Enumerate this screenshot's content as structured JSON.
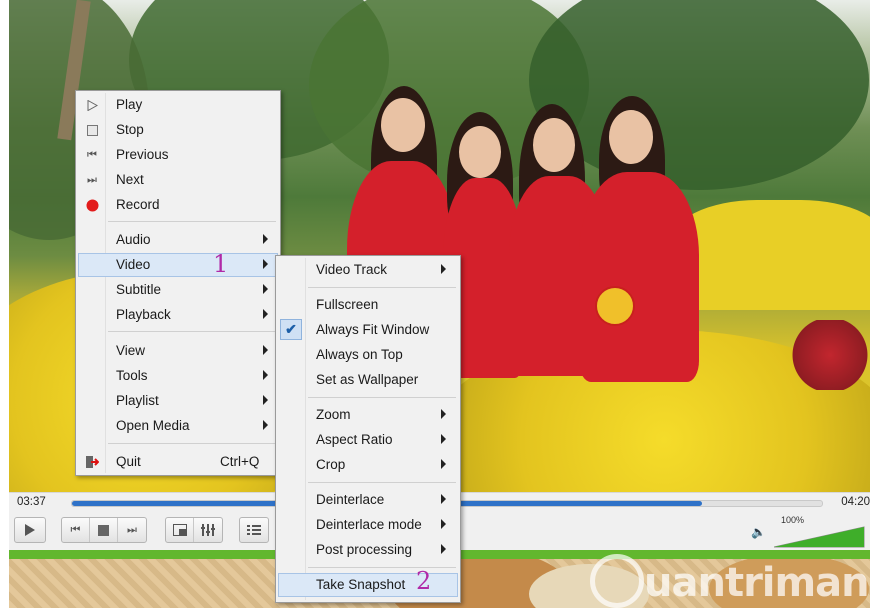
{
  "main_menu": {
    "items": [
      {
        "label": "Play",
        "icon": "play-icon"
      },
      {
        "label": "Stop",
        "icon": "stop-icon"
      },
      {
        "label": "Previous",
        "icon": "previous-icon"
      },
      {
        "label": "Next",
        "icon": "next-icon"
      },
      {
        "label": "Record",
        "icon": "record-icon"
      },
      {
        "label": "Audio",
        "submenu": true
      },
      {
        "label": "Video",
        "submenu": true,
        "highlighted": true
      },
      {
        "label": "Subtitle",
        "submenu": true
      },
      {
        "label": "Playback",
        "submenu": true
      },
      {
        "label": "View",
        "submenu": true
      },
      {
        "label": "Tools",
        "submenu": true
      },
      {
        "label": "Playlist",
        "submenu": true
      },
      {
        "label": "Open Media",
        "submenu": true
      },
      {
        "label": "Quit",
        "shortcut": "Ctrl+Q",
        "icon": "quit-icon"
      }
    ]
  },
  "video_menu": {
    "items": [
      {
        "label": "Video Track",
        "submenu": true
      },
      {
        "label": "Fullscreen"
      },
      {
        "label": "Always Fit Window",
        "checked": true
      },
      {
        "label": "Always on Top"
      },
      {
        "label": "Set as Wallpaper"
      },
      {
        "label": "Zoom",
        "submenu": true
      },
      {
        "label": "Aspect Ratio",
        "submenu": true
      },
      {
        "label": "Crop",
        "submenu": true
      },
      {
        "label": "Deinterlace",
        "submenu": true
      },
      {
        "label": "Deinterlace mode",
        "submenu": true
      },
      {
        "label": "Post processing",
        "submenu": true
      },
      {
        "label": "Take Snapshot",
        "highlighted": true
      }
    ]
  },
  "annotations": {
    "marker_1": "1",
    "marker_2": "2"
  },
  "player": {
    "elapsed": "03:37",
    "total": "04:20",
    "progress": 0.84,
    "volume_label": "100%",
    "volume": 1.0
  },
  "watermark": "uantrimang",
  "colors": {
    "accent": "#2f72c8",
    "volume_green": "#62b72e",
    "marker": "#b02aa8",
    "record": "#e21b1b"
  }
}
